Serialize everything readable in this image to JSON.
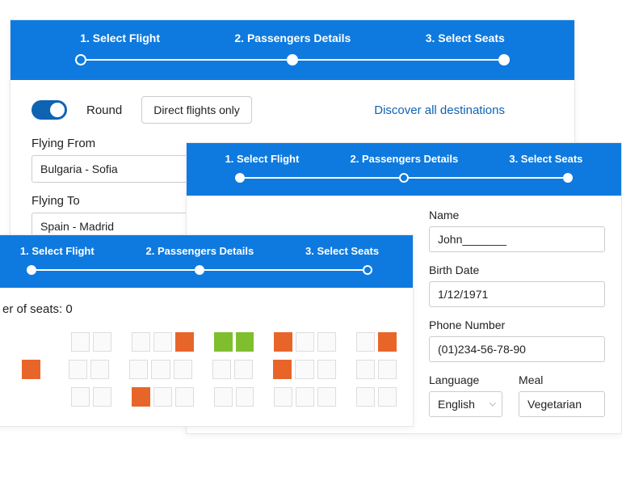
{
  "steps": {
    "s1": "1. Select Flight",
    "s2": "2. Passengers Details",
    "s3": "3. Select Seats"
  },
  "card1": {
    "round_label": "Round",
    "direct_label": "Direct flights only",
    "discover_link": "Discover all destinations",
    "from_label": "Flying From",
    "from_value": "Bulgaria - Sofia",
    "to_label": "Flying To",
    "to_value": "Spain - Madrid"
  },
  "card2": {
    "name_label": "Name",
    "name_value": "John_______",
    "birth_label": "Birth Date",
    "birth_value": "1/12/1971",
    "phone_label": "Phone Number",
    "phone_value": "(01)234-56-78-90",
    "lang_label": "Language",
    "lang_value": "English",
    "meal_label": "Meal",
    "meal_value": "Vegetarian"
  },
  "card3": {
    "seats_text": "er of seats:  0"
  }
}
